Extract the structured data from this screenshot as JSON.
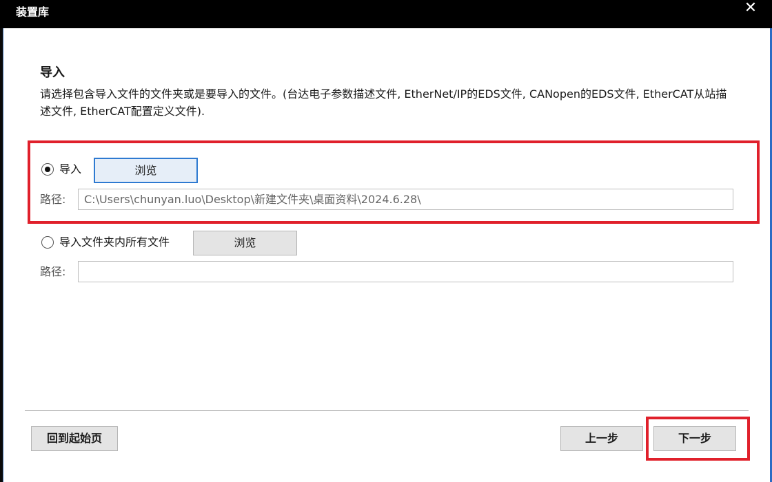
{
  "window": {
    "title": "装置库",
    "close_glyph": "✕"
  },
  "import_section": {
    "heading": "导入",
    "description": "请选择包含导入文件的文件夹或是要导入的文件。(台达电子参数描述文件, EtherNet/IP的EDS文件, CANopen的EDS文件, EtherCAT从站描述文件, EtherCAT配置定义文件)."
  },
  "option_import": {
    "selected": true,
    "label": "导入",
    "browse_label": "浏览",
    "path_label": "路径:",
    "path_value": "C:\\Users\\chunyan.luo\\Desktop\\新建文件夹\\桌面资料\\2024.6.28\\"
  },
  "option_folder": {
    "selected": false,
    "label": "导入文件夹内所有文件",
    "browse_label": "浏览",
    "path_label": "路径:",
    "path_value": ""
  },
  "footer": {
    "home_label": "回到起始页",
    "prev_label": "上一步",
    "next_label": "下一步"
  },
  "colors": {
    "titlebar": "#000000",
    "highlight_box": "#e0202b",
    "focus_border": "#2e7ad1"
  }
}
